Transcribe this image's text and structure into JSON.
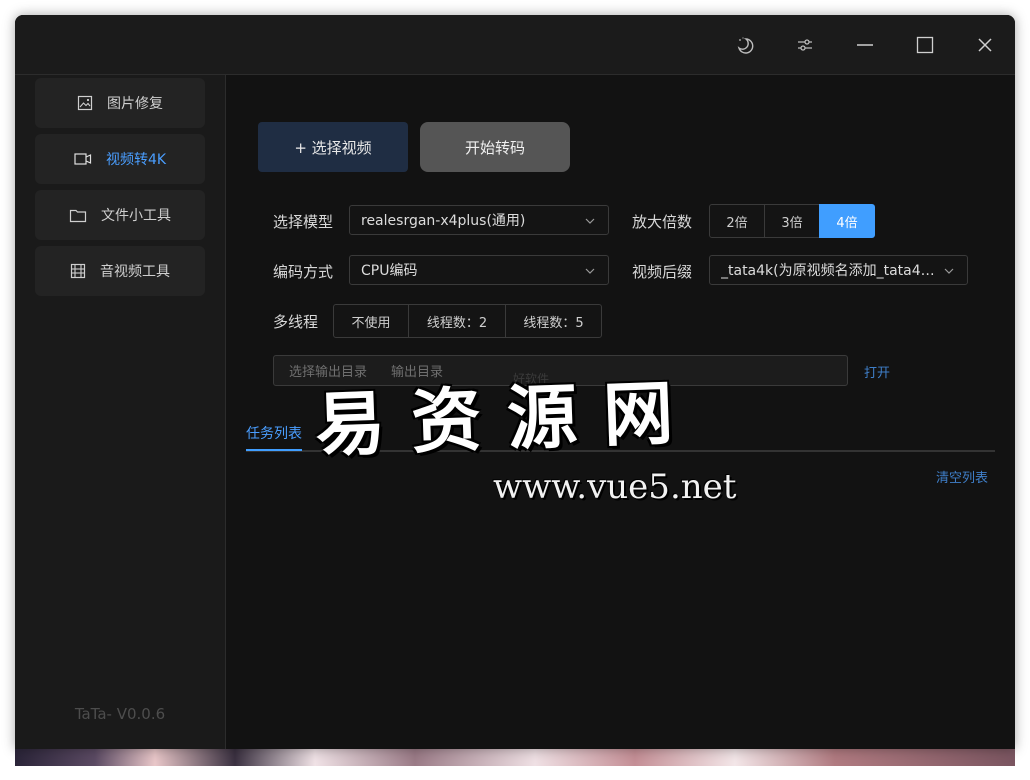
{
  "window": {
    "title_icons": [
      "moon-icon",
      "sliders-icon",
      "minimize-icon",
      "maximize-icon",
      "close-icon"
    ]
  },
  "sidebar": {
    "items": [
      {
        "label": "图片修复",
        "icon": "image-icon",
        "active": false
      },
      {
        "label": "视频转4K",
        "icon": "video-icon",
        "active": true
      },
      {
        "label": "文件小工具",
        "icon": "folder-icon",
        "active": false
      },
      {
        "label": "音视频工具",
        "icon": "film-icon",
        "active": false
      }
    ],
    "version": "TaTa- V0.0.6"
  },
  "toolbar": {
    "select_video_label": "+ 选择视频",
    "start_label": "开始转码"
  },
  "form": {
    "model_label": "选择模型",
    "model_value": "realesrgan-x4plus(通用)",
    "scale_label": "放大倍数",
    "scale_options": [
      "2倍",
      "3倍",
      "4倍"
    ],
    "scale_selected": "4倍",
    "encode_label": "编码方式",
    "encode_value": "CPU编码",
    "suffix_label": "视频后缀",
    "suffix_value": "_tata4k(为原视频名添加_tata4k...",
    "thread_label": "多线程",
    "thread_options": [
      "不使用",
      "线程数：2",
      "线程数：5"
    ],
    "output_placeholder": "选择输出目录",
    "output_secondary": "输出目录",
    "open_label": "打开"
  },
  "tasks": {
    "tab_label": "任务列表",
    "clear_label": "清空列表"
  },
  "watermark": {
    "big": "易资源网",
    "url": "www.vue5.net",
    "faint": "好软件"
  },
  "colors": {
    "accent": "#409eff",
    "window_bg": "#121212",
    "sidebar_bg": "#1a1a1a"
  }
}
